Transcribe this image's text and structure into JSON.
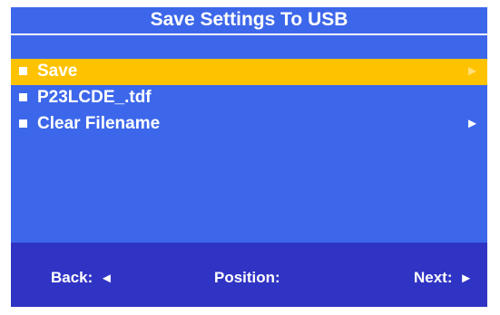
{
  "title": "Save Settings To USB",
  "menu": {
    "items": [
      {
        "label": "Save",
        "arrow": "►",
        "selected": true,
        "bullet_icon": "square-bullet-icon"
      },
      {
        "label": "P23LCDE_.tdf",
        "arrow": "",
        "selected": false,
        "bullet_icon": "square-bullet-icon"
      },
      {
        "label": "Clear Filename",
        "arrow": "►",
        "selected": false,
        "bullet_icon": "square-bullet-icon"
      }
    ]
  },
  "footer": {
    "back_label": "Back:",
    "back_glyph": "◄",
    "position_label": "Position:",
    "next_label": "Next:",
    "next_glyph": "►"
  },
  "colors": {
    "background": "#3d67ea",
    "selection": "#ffc200",
    "footer": "#3034c4",
    "text": "#ffffff"
  }
}
